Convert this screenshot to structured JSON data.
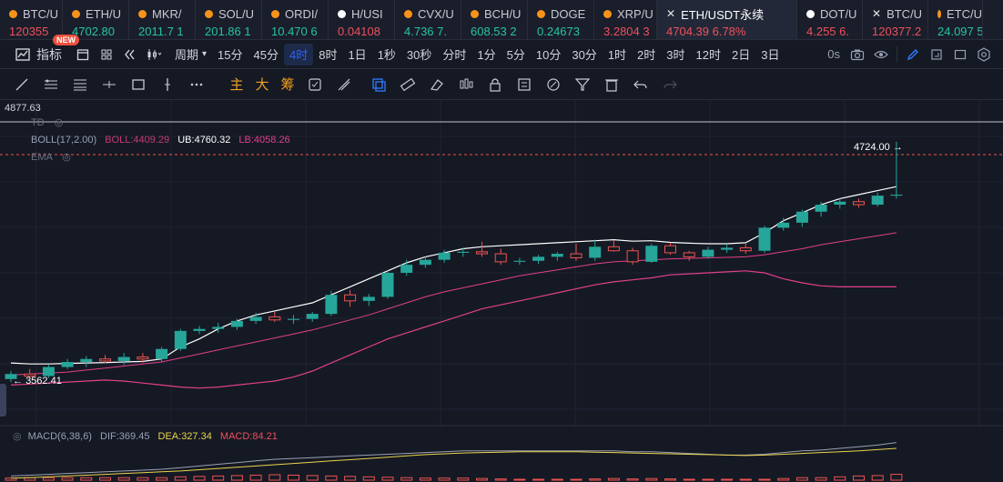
{
  "tickers": [
    {
      "symbol": "BTC/U",
      "price": "120355",
      "dir": "down",
      "icon": "dot-icon",
      "color": "#f7931a",
      "w": 69
    },
    {
      "symbol": "ETH/U",
      "price": "4702.80",
      "dir": "up",
      "icon": "dot-icon",
      "color": "#f7931a",
      "w": 73
    },
    {
      "symbol": "MKR/",
      "price": "2011.7 1",
      "dir": "up",
      "icon": "dot-icon",
      "color": "#f7931a",
      "w": 73
    },
    {
      "symbol": "SOL/U",
      "price": "201.86 1",
      "dir": "up",
      "icon": "dot-icon",
      "color": "#f7931a",
      "w": 73
    },
    {
      "symbol": "ORDI/",
      "price": "10.470 6",
      "dir": "up",
      "icon": "dot-icon",
      "color": "#f7931a",
      "w": 73
    },
    {
      "symbol": "H/USI",
      "price": "0.04108",
      "dir": "down",
      "icon": "dot-icon",
      "color": "#ffffff",
      "w": 73
    },
    {
      "symbol": "CVX/U",
      "price": "4.736 7.",
      "dir": "up",
      "icon": "dot-icon",
      "color": "#f7931a",
      "w": 73
    },
    {
      "symbol": "BCH/U",
      "price": "608.53 2",
      "dir": "up",
      "icon": "dot-icon",
      "color": "#f7931a",
      "w": 73
    },
    {
      "symbol": "DOGE",
      "price": "0.24673",
      "dir": "up",
      "icon": "dot-icon",
      "color": "#f7931a",
      "w": 73
    },
    {
      "symbol": "XRP/U",
      "price": "3.2804 3",
      "dir": "down",
      "icon": "dot-icon",
      "color": "#f7931a",
      "w": 69
    },
    {
      "symbol": "ETH/USDT永续",
      "price": "4704.39 6.78%",
      "dir": "down",
      "icon": "x-icon",
      "color": "#ffffff",
      "w": 154,
      "active": true
    },
    {
      "symbol": "DOT/U",
      "price": "4.255 6.",
      "dir": "down",
      "icon": "dot-icon",
      "color": "#ffffff",
      "w": 72
    },
    {
      "symbol": "BTC/U",
      "price": "120377.2",
      "dir": "down",
      "icon": "x-icon",
      "color": "#ffffff",
      "w": 72
    },
    {
      "symbol": "ETC/U",
      "price": "24.097 5",
      "dir": "up",
      "icon": "dot-icon",
      "color": "#f7931a",
      "w": 60
    }
  ],
  "toolbar": {
    "indicators_label": "指标",
    "new_badge": "NEW",
    "period_label": "周期",
    "intervals": [
      "15分",
      "45分",
      "4时",
      "8时",
      "1日",
      "1秒",
      "30秒",
      "分时",
      "1分",
      "5分",
      "10分",
      "30分",
      "1时",
      "2时",
      "3时",
      "12时",
      "2日",
      "3日"
    ],
    "active_interval": "4时",
    "timer_label": "0s"
  },
  "drawing_tools": {
    "text_buttons": [
      "主",
      "大",
      "筹"
    ]
  },
  "indicators": {
    "td_label": "TD",
    "boll_label": "BOLL(17,2.00)",
    "boll_value": "BOLL:4409.29",
    "ub_value": "UB:4760.32",
    "lb_value": "LB:4058.26",
    "ema_label": "EMA",
    "macd_label": "MACD(6,38,6)",
    "dif_value": "DIF:369.45",
    "dea_value": "DEA:327.34",
    "macd_value": "MACD:84.21"
  },
  "price_labels": {
    "top_price": "4877.63",
    "high_marker": "4724.00",
    "low_marker": "3562.41"
  },
  "colors": {
    "up": "#26a69a",
    "down": "#ef5350",
    "boll_mid": "#e0408a",
    "ub": "#ffffff",
    "lb": "#e0408a",
    "dea": "#e8d44d",
    "dif": "#9aa0b4"
  },
  "chart_data": {
    "type": "candlestick",
    "y_range": [
      3480,
      4877.63
    ],
    "candles": [
      [
        3540,
        3580,
        3525,
        3565
      ],
      [
        3565,
        3590,
        3545,
        3555
      ],
      [
        3555,
        3610,
        3545,
        3600
      ],
      [
        3600,
        3640,
        3590,
        3625
      ],
      [
        3625,
        3655,
        3600,
        3640
      ],
      [
        3640,
        3660,
        3620,
        3630
      ],
      [
        3630,
        3670,
        3610,
        3650
      ],
      [
        3650,
        3670,
        3620,
        3640
      ],
      [
        3640,
        3700,
        3625,
        3690
      ],
      [
        3690,
        3790,
        3680,
        3780
      ],
      [
        3780,
        3805,
        3765,
        3790
      ],
      [
        3790,
        3820,
        3770,
        3800
      ],
      [
        3800,
        3840,
        3785,
        3830
      ],
      [
        3830,
        3870,
        3815,
        3850
      ],
      [
        3850,
        3875,
        3825,
        3835
      ],
      [
        3835,
        3860,
        3815,
        3840
      ],
      [
        3840,
        3875,
        3825,
        3865
      ],
      [
        3865,
        3980,
        3855,
        3960
      ],
      [
        3960,
        3985,
        3900,
        3930
      ],
      [
        3930,
        3965,
        3905,
        3950
      ],
      [
        3950,
        4080,
        3940,
        4070
      ],
      [
        4070,
        4135,
        4055,
        4110
      ],
      [
        4110,
        4150,
        4095,
        4135
      ],
      [
        4135,
        4185,
        4120,
        4170
      ],
      [
        4170,
        4195,
        4150,
        4175
      ],
      [
        4175,
        4225,
        4150,
        4165
      ],
      [
        4165,
        4190,
        4110,
        4125
      ],
      [
        4125,
        4145,
        4110,
        4130
      ],
      [
        4130,
        4160,
        4115,
        4150
      ],
      [
        4150,
        4175,
        4130,
        4165
      ],
      [
        4165,
        4215,
        4130,
        4145
      ],
      [
        4145,
        4235,
        4130,
        4200
      ],
      [
        4200,
        4230,
        4175,
        4180
      ],
      [
        4180,
        4195,
        4110,
        4125
      ],
      [
        4125,
        4215,
        4120,
        4205
      ],
      [
        4205,
        4220,
        4160,
        4170
      ],
      [
        4170,
        4180,
        4130,
        4150
      ],
      [
        4150,
        4200,
        4140,
        4185
      ],
      [
        4185,
        4215,
        4170,
        4195
      ],
      [
        4195,
        4215,
        4165,
        4180
      ],
      [
        4180,
        4305,
        4170,
        4295
      ],
      [
        4295,
        4345,
        4280,
        4320
      ],
      [
        4320,
        4385,
        4300,
        4375
      ],
      [
        4375,
        4425,
        4350,
        4410
      ],
      [
        4410,
        4440,
        4390,
        4425
      ],
      [
        4425,
        4440,
        4395,
        4410
      ],
      [
        4410,
        4470,
        4400,
        4455
      ],
      [
        4455,
        4724,
        4440,
        4460
      ]
    ],
    "boll_ub": [
      3620,
      3615,
      3615,
      3618,
      3620,
      3622,
      3625,
      3628,
      3640,
      3700,
      3740,
      3790,
      3830,
      3860,
      3880,
      3900,
      3920,
      3960,
      4000,
      4040,
      4080,
      4120,
      4150,
      4170,
      4190,
      4200,
      4205,
      4210,
      4215,
      4220,
      4225,
      4230,
      4235,
      4228,
      4230,
      4222,
      4218,
      4215,
      4215,
      4220,
      4270,
      4330,
      4370,
      4410,
      4440,
      4460,
      4480,
      4500
    ],
    "boll_mid": [
      3560,
      3565,
      3570,
      3575,
      3585,
      3595,
      3605,
      3615,
      3625,
      3645,
      3665,
      3685,
      3705,
      3725,
      3745,
      3765,
      3785,
      3810,
      3835,
      3860,
      3890,
      3920,
      3950,
      3975,
      3995,
      4015,
      4035,
      4055,
      4070,
      4085,
      4100,
      4115,
      4125,
      4130,
      4135,
      4140,
      4142,
      4145,
      4147,
      4150,
      4160,
      4175,
      4190,
      4210,
      4225,
      4240,
      4255,
      4270
    ],
    "boll_lb": [
      3510,
      3515,
      3520,
      3525,
      3530,
      3535,
      3530,
      3520,
      3510,
      3500,
      3495,
      3500,
      3510,
      3520,
      3530,
      3550,
      3580,
      3620,
      3660,
      3700,
      3740,
      3770,
      3800,
      3830,
      3860,
      3890,
      3910,
      3930,
      3950,
      3970,
      3990,
      4010,
      4025,
      4035,
      4045,
      4060,
      4065,
      4070,
      4075,
      4080,
      4070,
      4040,
      4020,
      4005,
      4000,
      4000,
      4000,
      4000
    ],
    "macd_dif": [
      10,
      12,
      14,
      16,
      18,
      20,
      22,
      24,
      26,
      30,
      34,
      38,
      42,
      46,
      50,
      52,
      54,
      56,
      58,
      60,
      62,
      64,
      66,
      68,
      70,
      70,
      70,
      70,
      70,
      70,
      70,
      70,
      70,
      68,
      68,
      66,
      64,
      62,
      60,
      60,
      62,
      66,
      70,
      72,
      76,
      80,
      84,
      90
    ],
    "macd_dea": [
      5,
      6,
      8,
      10,
      12,
      14,
      16,
      18,
      20,
      22,
      25,
      28,
      31,
      34,
      37,
      40,
      43,
      46,
      49,
      52,
      55,
      58,
      61,
      63,
      65,
      66,
      67,
      68,
      68,
      68,
      68,
      67,
      66,
      65,
      64,
      63,
      62,
      61,
      60,
      59,
      60,
      62,
      64,
      66,
      68,
      70,
      73,
      76
    ],
    "macd_hist": [
      5,
      6,
      6,
      6,
      6,
      6,
      6,
      6,
      6,
      8,
      9,
      10,
      11,
      12,
      13,
      12,
      11,
      10,
      9,
      8,
      7,
      6,
      5,
      5,
      5,
      4,
      3,
      2,
      2,
      2,
      2,
      3,
      4,
      3,
      4,
      3,
      2,
      1,
      0,
      1,
      2,
      4,
      6,
      6,
      8,
      10,
      11,
      14
    ]
  }
}
